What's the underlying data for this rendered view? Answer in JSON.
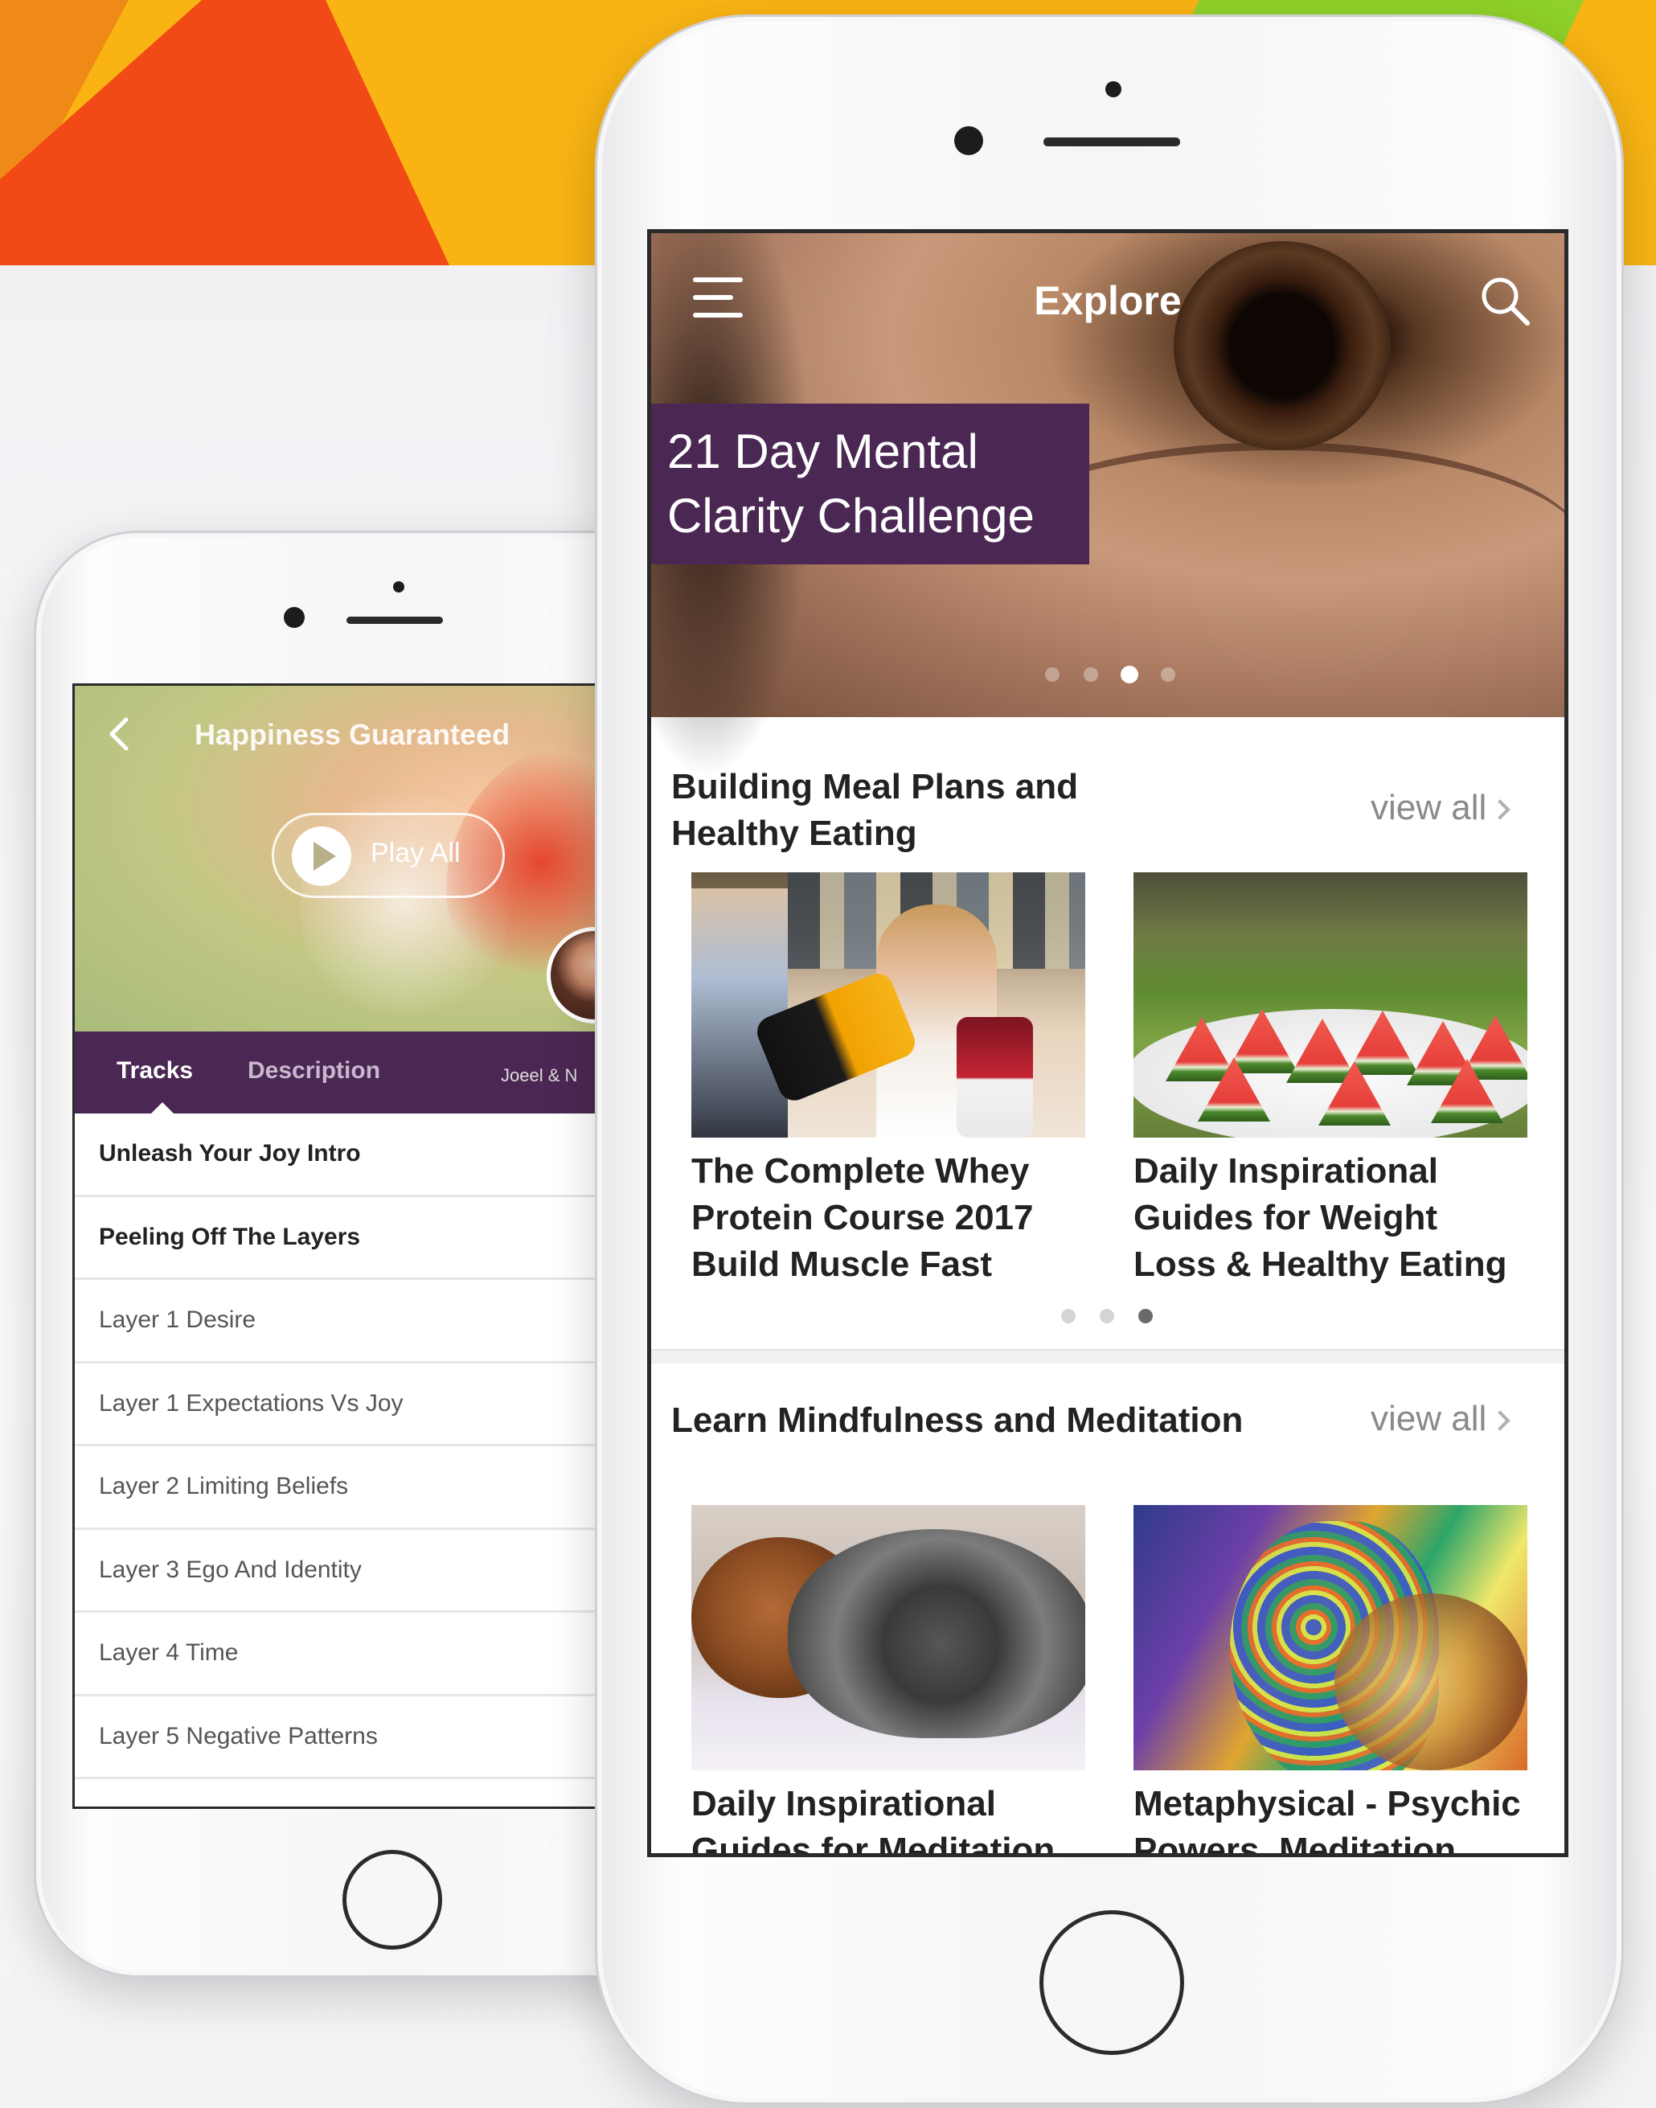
{
  "back_screen": {
    "title": "Happiness Guaranteed",
    "play_all_label": "Play All",
    "tabs": [
      {
        "label": "Tracks"
      },
      {
        "label": "Description"
      },
      {
        "label": "Jo&sect;el & N"
      }
    ],
    "author_partial": "Joeel & N",
    "tracks": [
      {
        "label": "Unleash Your Joy Intro"
      },
      {
        "label": "Peeling Off The Layers"
      },
      {
        "label": "Layer 1 Desire"
      },
      {
        "label": "Layer 1 Expectations Vs Joy"
      },
      {
        "label": "Layer 2 Limiting Beliefs"
      },
      {
        "label": "Layer 3 Ego And Identity"
      },
      {
        "label": "Layer 4 Time"
      },
      {
        "label": "Layer 5 Negative Patterns"
      }
    ],
    "icons": {
      "back": "chevron-left-icon",
      "play": "play-icon"
    }
  },
  "front_screen": {
    "title": "Explore",
    "icons": {
      "menu": "hamburger-menu-icon",
      "search": "search-icon",
      "chevron": "chevron-right-icon"
    },
    "hero": {
      "banner_text": "21 Day Mental\nClarity Challenge",
      "pagination": {
        "count": 4,
        "active_index": 2
      }
    },
    "sections": [
      {
        "title": "Building Meal Plans and\nHealthy Eating",
        "view_all_label": "view all",
        "cards": [
          {
            "title": "The Complete Whey\nProtein Course 2017\nBuild Muscle Fast"
          },
          {
            "title": "Daily Inspirational\nGuides for Weight\nLoss & Healthy Eating"
          }
        ],
        "pagination": {
          "count": 3,
          "active_index": 2
        }
      },
      {
        "title": "Learn Mindfulness and Meditation",
        "view_all_label": "view all",
        "cards": [
          {
            "title": "Daily Inspirational\nGuides for Meditation"
          },
          {
            "title": "Metaphysical - Psychic\nPowers, Meditation"
          }
        ]
      }
    ]
  },
  "colors": {
    "brand_purple": "#4b2853",
    "background_yellow": "#f9b414",
    "background_orange": "#f24a16",
    "background_green": "#8fd12a",
    "muted_text": "#8a8a8a"
  }
}
